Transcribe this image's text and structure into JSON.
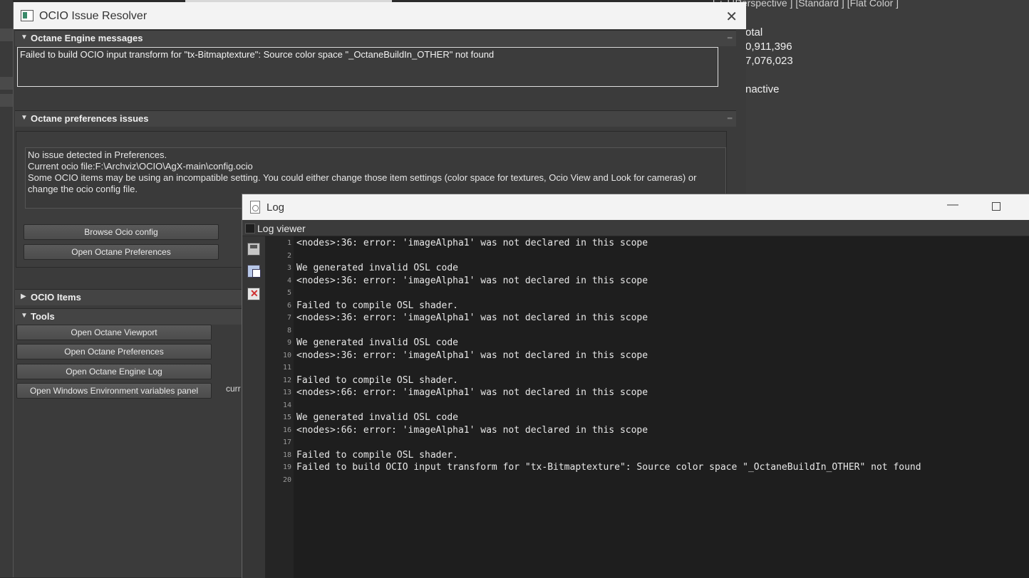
{
  "background": {
    "viewport_label": "[ + ] [Perspective ] [Standard ] [Flat Color ]",
    "stats": {
      "header": "otal",
      "line1": "0,911,396",
      "line2": "7,076,023",
      "line3": "nactive"
    }
  },
  "ocio_window": {
    "title": "OCIO Issue Resolver",
    "sections": {
      "engine": {
        "label": "Octane Engine messages",
        "expanded": true
      },
      "preferences": {
        "label": "Octane preferences issues",
        "expanded": true
      },
      "items": {
        "label": "OCIO Items",
        "expanded": false
      },
      "tools": {
        "label": "Tools",
        "expanded": true
      }
    },
    "engine_message": "Failed to build OCIO input transform for \"tx-Bitmaptexture\": Source color space \"_OctaneBuildIn_OTHER\" not found",
    "pref_lines": [
      "No issue detected in Preferences.",
      "Current ocio file:F:\\Archviz\\OCIO\\AgX-main\\config.ocio",
      "Some OCIO items may be using an incompatible setting. You could either change those item settings (color space for textures, Ocio View and Look for cameras) or",
      "change the ocio config file."
    ],
    "pref_buttons": {
      "browse": "Browse Ocio config",
      "open_prefs": "Open Octane Preferences"
    },
    "tool_buttons": {
      "viewport": "Open Octane Viewport",
      "prefs": "Open Octane Preferences",
      "engine_log": "Open Octane Engine Log",
      "env_panel": "Open Windows Environment variables panel"
    },
    "side_text": "curr"
  },
  "log_window": {
    "title": "Log",
    "subbar_label": "Log viewer",
    "lines": [
      {
        "n": "1",
        "t": "<nodes>:36: error: 'imageAlpha1' was not declared in this scope"
      },
      {
        "n": "2",
        "t": ""
      },
      {
        "n": "3",
        "t": "We generated invalid OSL code"
      },
      {
        "n": "4",
        "t": "<nodes>:36: error: 'imageAlpha1' was not declared in this scope"
      },
      {
        "n": "5",
        "t": ""
      },
      {
        "n": "6",
        "t": "Failed to compile OSL shader."
      },
      {
        "n": "7",
        "t": "<nodes>:36: error: 'imageAlpha1' was not declared in this scope"
      },
      {
        "n": "8",
        "t": ""
      },
      {
        "n": "9",
        "t": "We generated invalid OSL code"
      },
      {
        "n": "10",
        "t": "<nodes>:36: error: 'imageAlpha1' was not declared in this scope"
      },
      {
        "n": "11",
        "t": ""
      },
      {
        "n": "12",
        "t": "Failed to compile OSL shader."
      },
      {
        "n": "13",
        "t": "<nodes>:66: error: 'imageAlpha1' was not declared in this scope"
      },
      {
        "n": "14",
        "t": ""
      },
      {
        "n": "15",
        "t": "We generated invalid OSL code"
      },
      {
        "n": "16",
        "t": "<nodes>:66: error: 'imageAlpha1' was not declared in this scope"
      },
      {
        "n": "17",
        "t": ""
      },
      {
        "n": "18",
        "t": "Failed to compile OSL shader."
      },
      {
        "n": "19",
        "t": "Failed to build OCIO input transform for \"tx-Bitmaptexture\": Source color space \"_OctaneBuildIn_OTHER\" not found"
      },
      {
        "n": "20",
        "t": ""
      }
    ]
  }
}
